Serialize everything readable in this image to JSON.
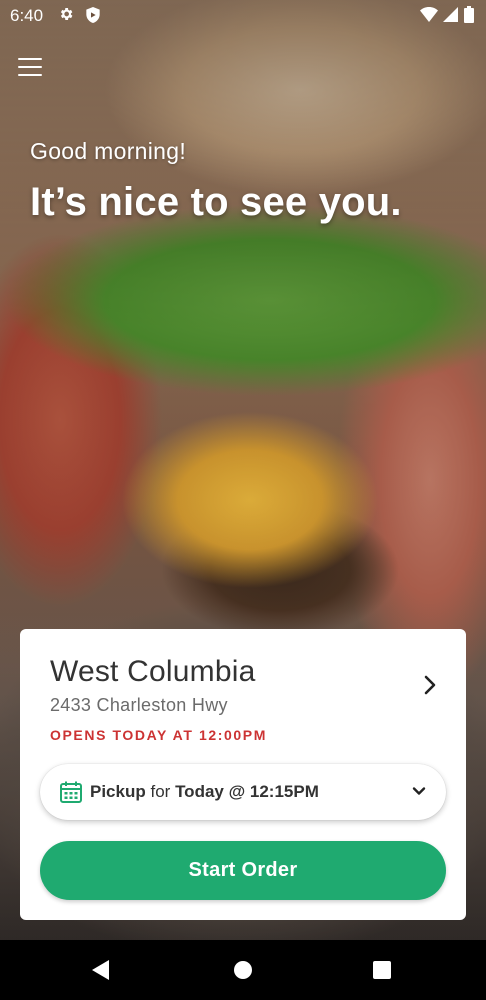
{
  "status_bar": {
    "time": "6:40",
    "icons": [
      "gear-icon",
      "shield-icon",
      "wifi-icon",
      "signal-icon",
      "battery-icon"
    ]
  },
  "header": {
    "menu_icon": "hamburger-menu-icon",
    "greeting": "Good morning!",
    "headline": "It’s nice to see you."
  },
  "location_card": {
    "store_name": "West Columbia",
    "address": "2433 Charleston Hwy",
    "hours_status": "OPENS TODAY AT 12:00PM",
    "hours_color": "#cc3333",
    "chevron_icon": "chevron-right-icon",
    "pickup": {
      "mode": "Pickup",
      "connector": "for",
      "time": "Today @ 12:15PM",
      "icon": "calendar-icon",
      "dropdown_icon": "chevron-down-icon"
    },
    "start_order_label": "Start Order",
    "accent_color": "#1faa70"
  },
  "nav_bar": {
    "buttons": [
      "back",
      "home",
      "recents"
    ]
  }
}
